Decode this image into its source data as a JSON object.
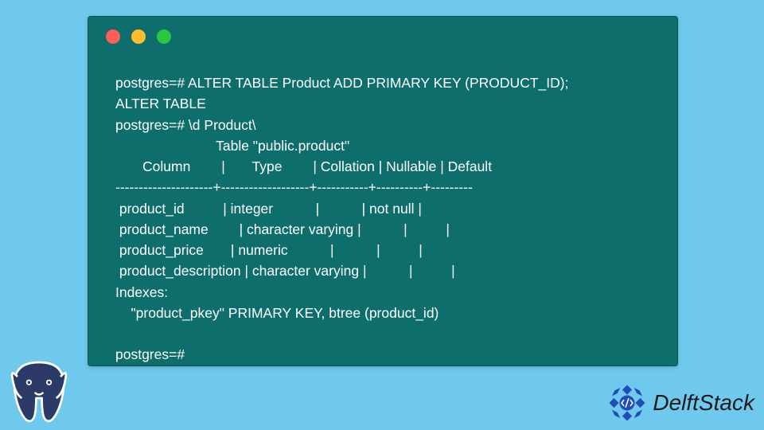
{
  "terminal": {
    "lines": {
      "l1": "postgres=# ALTER TABLE Product ADD PRIMARY KEY (PRODUCT_ID);",
      "l2": "ALTER TABLE",
      "l3": "postgres=# \\d Product\\",
      "l4": "                          Table \"public.product\"",
      "l5": "       Column        |       Type        | Collation | Nullable | Default",
      "l6": "---------------------+-------------------+-----------+----------+---------",
      "l7": " product_id          | integer           |           | not null |",
      "l8": " product_name        | character varying |           |          |",
      "l9": " product_price       | numeric           |           |          |",
      "l10": " product_description | character varying |           |          |",
      "l11": "Indexes:",
      "l12": "    \"product_pkey\" PRIMARY KEY, btree (product_id)",
      "l13": "",
      "l14": "postgres=#"
    }
  },
  "brand": {
    "name": "DelftStack"
  }
}
